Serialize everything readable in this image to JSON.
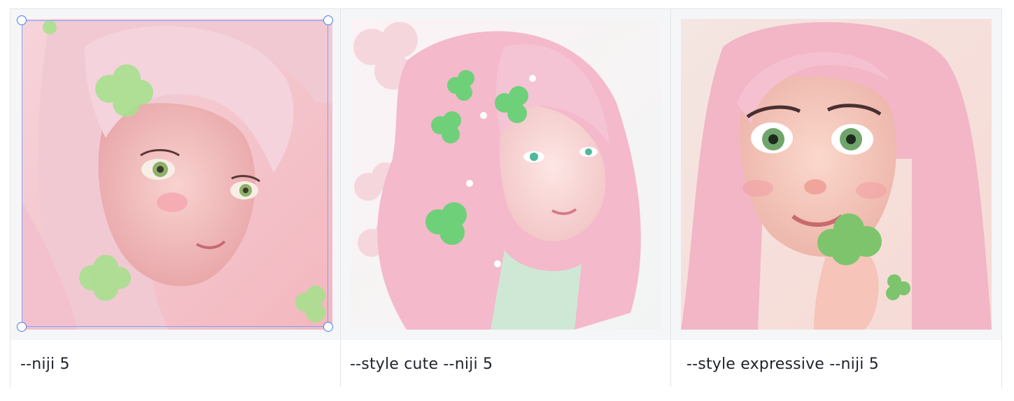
{
  "gallery": {
    "items": [
      {
        "caption": "--niji 5",
        "image": "pink-haired-girl-with-clovers-illustration",
        "selected": true
      },
      {
        "caption": "--style cute --niji 5",
        "image": "pink-haired-girl-with-clovers-soft-watercolor",
        "selected": false
      },
      {
        "caption": "--style expressive --niji 5",
        "image": "pink-haired-girl-holding-clover-3d",
        "selected": false
      }
    ]
  },
  "colors": {
    "selection_border": "#7aa5ff",
    "selection_handle": "#4b7cf3",
    "grid_border": "#e3e5e8",
    "image_row_bg": "#f5f6f8"
  }
}
